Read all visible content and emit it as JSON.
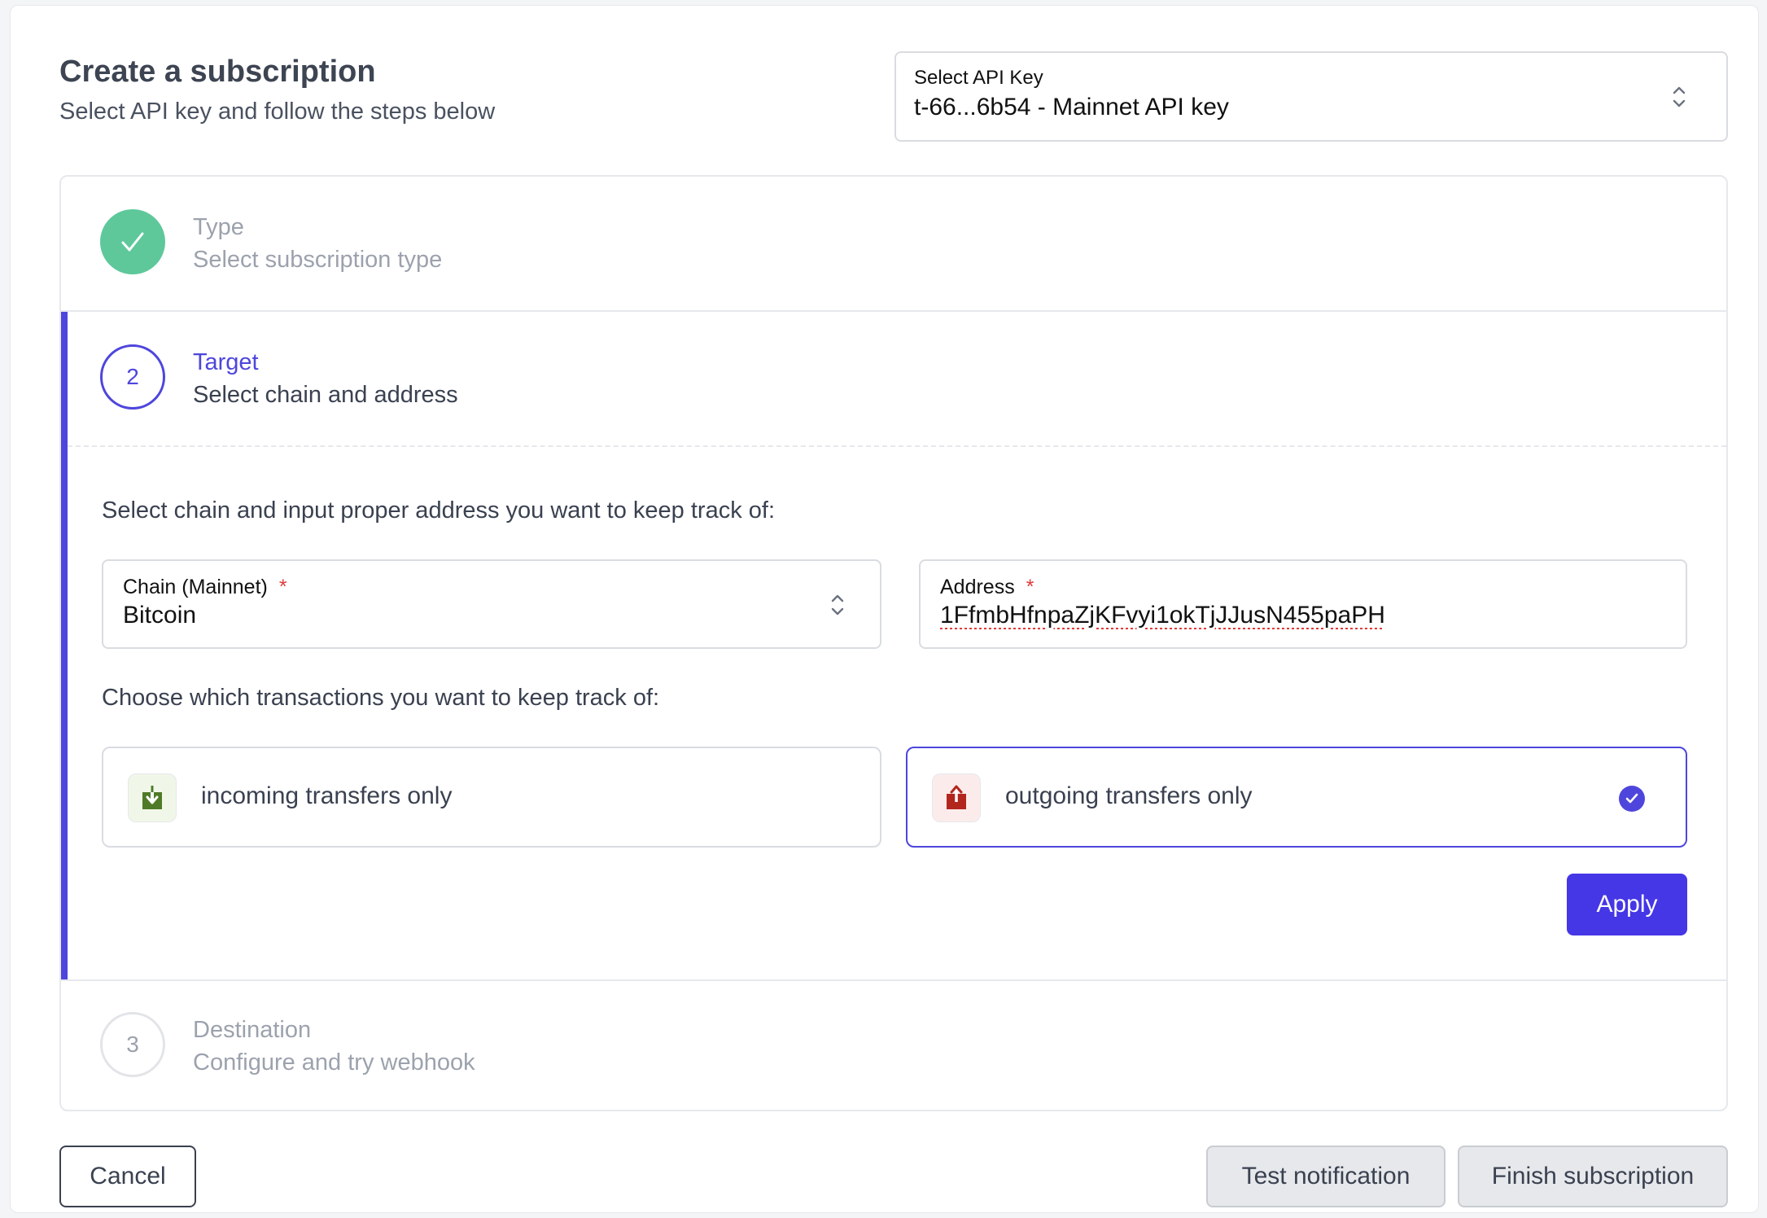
{
  "header": {
    "title": "Create a subscription",
    "subtitle": "Select API key and follow the steps below"
  },
  "api_key_select": {
    "label": "Select API Key",
    "value": "t-66...6b54 - Mainnet API key"
  },
  "steps": [
    {
      "number": "",
      "title": "Type",
      "description": "Select subscription type",
      "status": "completed"
    },
    {
      "number": "2",
      "title": "Target",
      "description": "Select chain and address",
      "status": "active"
    },
    {
      "number": "3",
      "title": "Destination",
      "description": "Configure and try webhook",
      "status": "pending"
    }
  ],
  "target": {
    "instruction": "Select chain and input proper address you want to keep track of:",
    "chain": {
      "label": "Chain (Mainnet)",
      "required_mark": "*",
      "value": "Bitcoin"
    },
    "address": {
      "label": "Address",
      "required_mark": "*",
      "value": "1FfmbHfnpaZjKFvyi1okTjJJusN455paPH"
    },
    "transactions_instruction": "Choose which transactions you want to keep track of:",
    "options": [
      {
        "label": "incoming transfers only",
        "selected": false,
        "icon": "download-icon",
        "color": "#4f7a28"
      },
      {
        "label": "outgoing transfers only",
        "selected": true,
        "icon": "upload-icon",
        "color": "#b3261e"
      }
    ],
    "apply_label": "Apply"
  },
  "footer": {
    "cancel_label": "Cancel",
    "test_label": "Test notification",
    "finish_label": "Finish subscription"
  },
  "colors": {
    "accent": "#4e46dc",
    "success": "#5ec89b",
    "required": "#e03a3a"
  }
}
